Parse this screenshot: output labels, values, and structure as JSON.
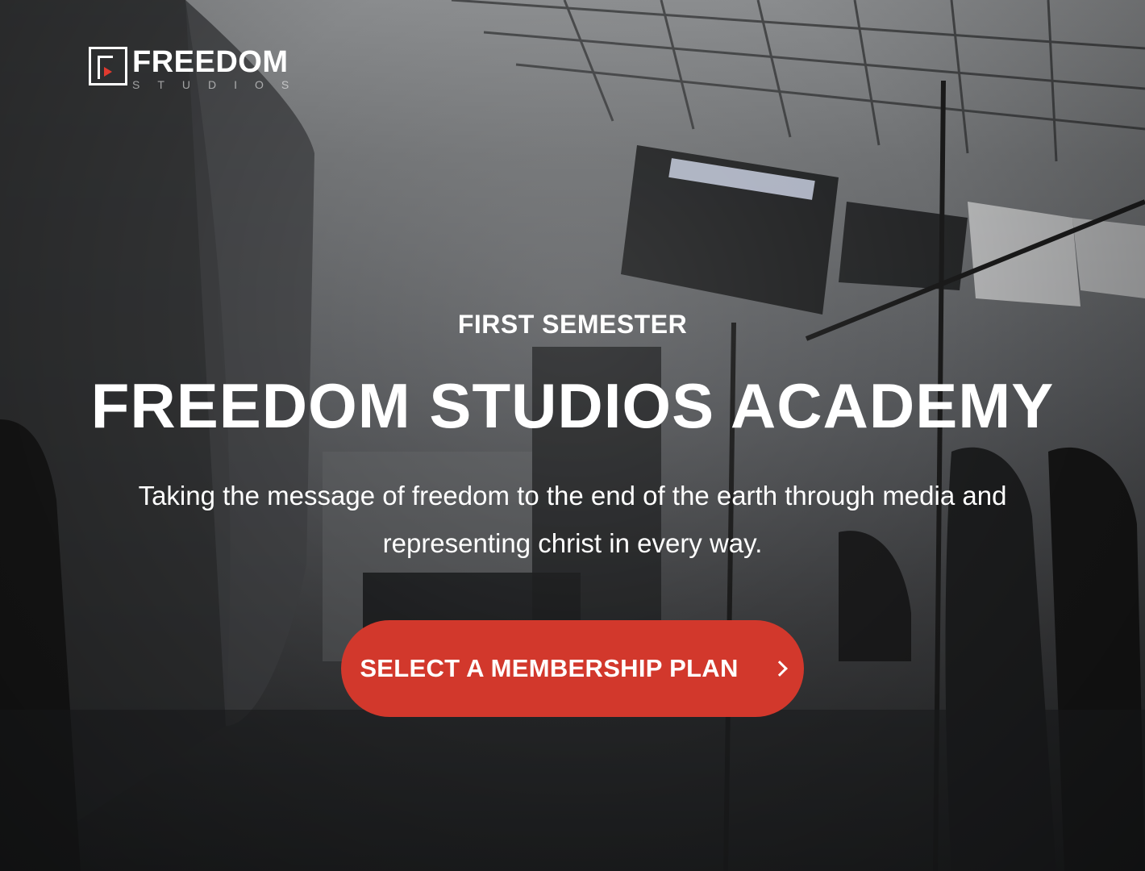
{
  "brand": {
    "logo_word": "FREEDOM",
    "logo_sub": "STUDIOS",
    "accent_color": "#d2382c"
  },
  "hero": {
    "eyebrow": "FIRST SEMESTER",
    "headline": "FREEDOM STUDIOS ACADEMY",
    "tagline": "Taking the message of freedom to the end of the earth through media and representing christ in every way.",
    "cta_label": "SELECT A MEMBERSHIP PLAN",
    "cta_icon": "chevron-right-icon"
  }
}
